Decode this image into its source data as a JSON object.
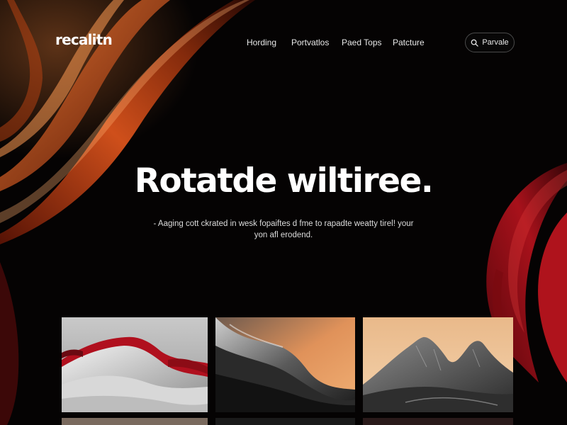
{
  "header": {
    "logo": "recalitn",
    "nav": [
      "Hording",
      "Portvatlos",
      "Paed Tops",
      "Patcture"
    ],
    "search_label": "Parvale"
  },
  "hero": {
    "title": "Rotatde wiltiree.",
    "subtitle_line1": "- Aaging cott ckrated in wesk fopaiftes d fme to rapadte weatty tirel! your",
    "subtitle_line2": "yon afl erodend."
  },
  "gallery": {
    "items": [
      "white-red-dunes-artwork",
      "dark-wave-sunset-artwork",
      "gray-mountains-artwork"
    ]
  },
  "icons": {
    "search": "search-icon"
  },
  "colors": {
    "background": "#050303",
    "accent_orange": "#e0551c",
    "accent_red": "#b8141c",
    "text": "#ffffff"
  }
}
